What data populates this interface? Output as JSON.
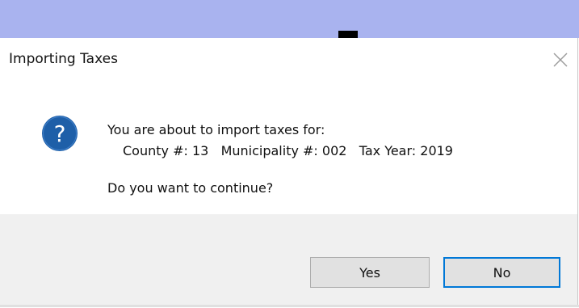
{
  "dialog": {
    "title": "Importing Taxes",
    "message_line1": "You are about to import taxes for:",
    "message_line2": "County #: 13   Municipality #: 002   Tax Year: 2019",
    "message_question": "Do you want to continue?",
    "icon": "question-icon",
    "buttons": {
      "yes_label": "Yes",
      "no_label": "No",
      "default_button": "No"
    },
    "colors": {
      "icon_blue": "#1e5fa8",
      "focus_border": "#0078d7",
      "background_strip": "#a9b3ef"
    }
  }
}
